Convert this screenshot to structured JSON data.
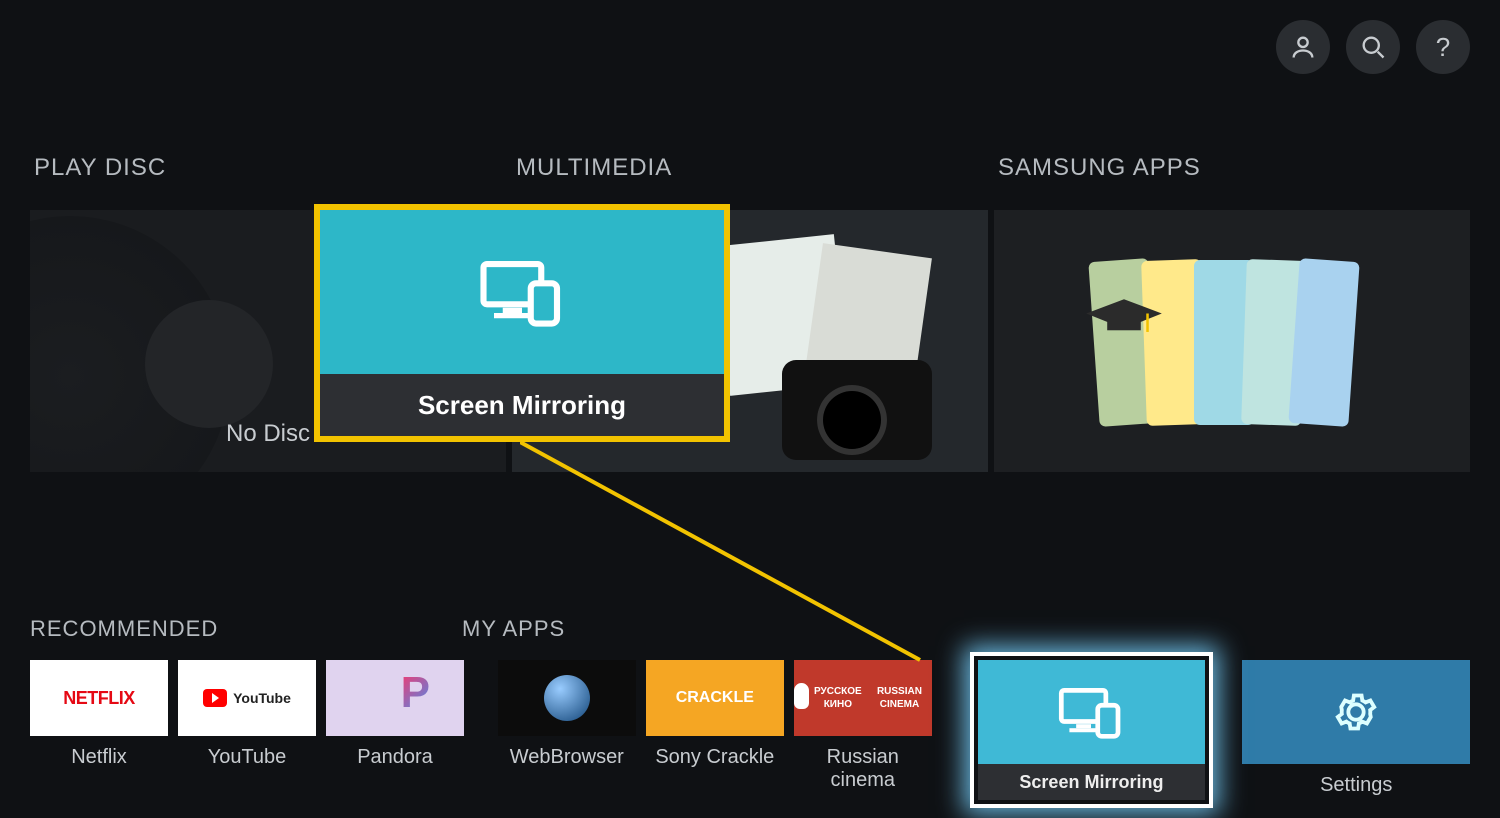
{
  "topIcons": [
    "profile",
    "search",
    "help"
  ],
  "sections": {
    "playDisc": {
      "header": "PLAY DISC",
      "caption": "No Disc"
    },
    "multimedia": {
      "header": "MULTIMEDIA"
    },
    "samsungApps": {
      "header": "SAMSUNG APPS"
    }
  },
  "callout": {
    "label": "Screen Mirroring"
  },
  "bottom": {
    "recommendedHeader": "RECOMMENDED",
    "myAppsHeader": "MY APPS",
    "recommended": [
      {
        "id": "netflix",
        "label": "Netflix",
        "thumbText": "NETFLIX"
      },
      {
        "id": "youtube",
        "label": "YouTube",
        "thumbText": "YouTube"
      },
      {
        "id": "pandora",
        "label": "Pandora",
        "thumbText": "P"
      }
    ],
    "myApps": [
      {
        "id": "web",
        "label": "WebBrowser"
      },
      {
        "id": "crackle",
        "label": "Sony Crackle",
        "thumbText": "CRACKLE"
      },
      {
        "id": "rucinema",
        "label": "Russian cinema",
        "thumbLine1": "РУССКОЕ КИНО",
        "thumbLine2": "RUSSIAN CINEMA"
      }
    ],
    "featured": [
      {
        "id": "screenmirror",
        "label": "Screen Mirroring",
        "caption": "Screen Mirroring",
        "selected": true
      },
      {
        "id": "settings",
        "label": "Settings"
      }
    ]
  }
}
